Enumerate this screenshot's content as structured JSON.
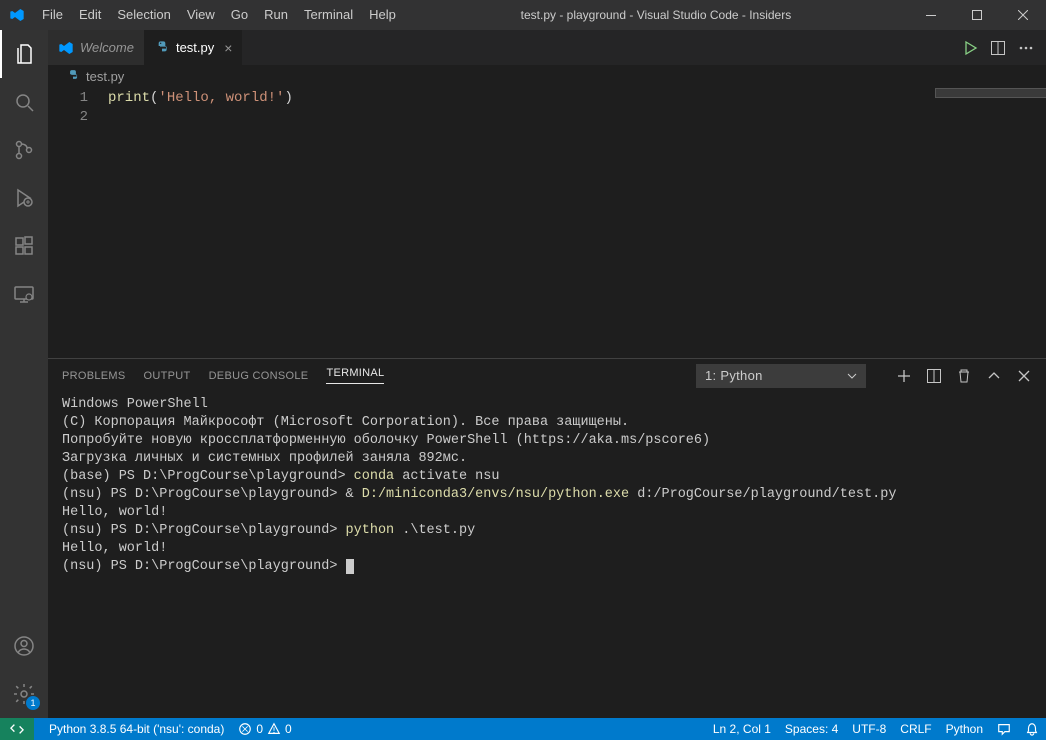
{
  "title": "test.py - playground - Visual Studio Code - Insiders",
  "menu": [
    "File",
    "Edit",
    "Selection",
    "View",
    "Go",
    "Run",
    "Terminal",
    "Help"
  ],
  "tabs": [
    {
      "label": "Welcome",
      "active": false
    },
    {
      "label": "test.py",
      "active": true
    }
  ],
  "breadcrumb": {
    "file": "test.py"
  },
  "editor": {
    "lines": {
      "1": {
        "fn": "print",
        "open": "(",
        "str": "'Hello, world!'",
        "close": ")"
      },
      "2": ""
    },
    "line_numbers": [
      "1",
      "2"
    ]
  },
  "panel_tabs": {
    "problems": "PROBLEMS",
    "output": "OUTPUT",
    "debug": "DEBUG CONSOLE",
    "terminal": "TERMINAL"
  },
  "terminal_selector": "1: Python",
  "terminal_lines": {
    "l1": "Windows PowerShell",
    "l2": "(C) Корпорация Майкрософт (Microsoft Corporation). Все права защищены.",
    "l3": "",
    "l4": "Попробуйте новую кроссплатформенную оболочку PowerShell (https://aka.ms/pscore6)",
    "l5": "",
    "l6": "Загрузка личных и системных профилей заняла 892мс.",
    "l7_prompt": "(base) PS D:\\ProgCourse\\playground> ",
    "l7_cmd": "conda",
    "l7_rest": " activate nsu",
    "l8_prompt": "(nsu) PS D:\\ProgCourse\\playground> ",
    "l8_amp": "& ",
    "l8_path": "D:/miniconda3/envs/nsu/python.exe",
    "l8_rest": " d:/ProgCourse/playground/test.py",
    "l9": "Hello, world!",
    "l10_prompt": "(nsu) PS D:\\ProgCourse\\playground> ",
    "l10_cmd": "python",
    "l10_rest": " .\\test.py",
    "l11": "Hello, world!",
    "l12_prompt": "(nsu) PS D:\\ProgCourse\\playground> "
  },
  "status": {
    "python": "Python 3.8.5 64-bit ('nsu': conda)",
    "errors": "0",
    "warnings": "0",
    "ln": "Ln 2, Col 1",
    "spaces": "Spaces: 4",
    "encoding": "UTF-8",
    "eol": "CRLF",
    "lang": "Python"
  },
  "settings_badge": "1"
}
